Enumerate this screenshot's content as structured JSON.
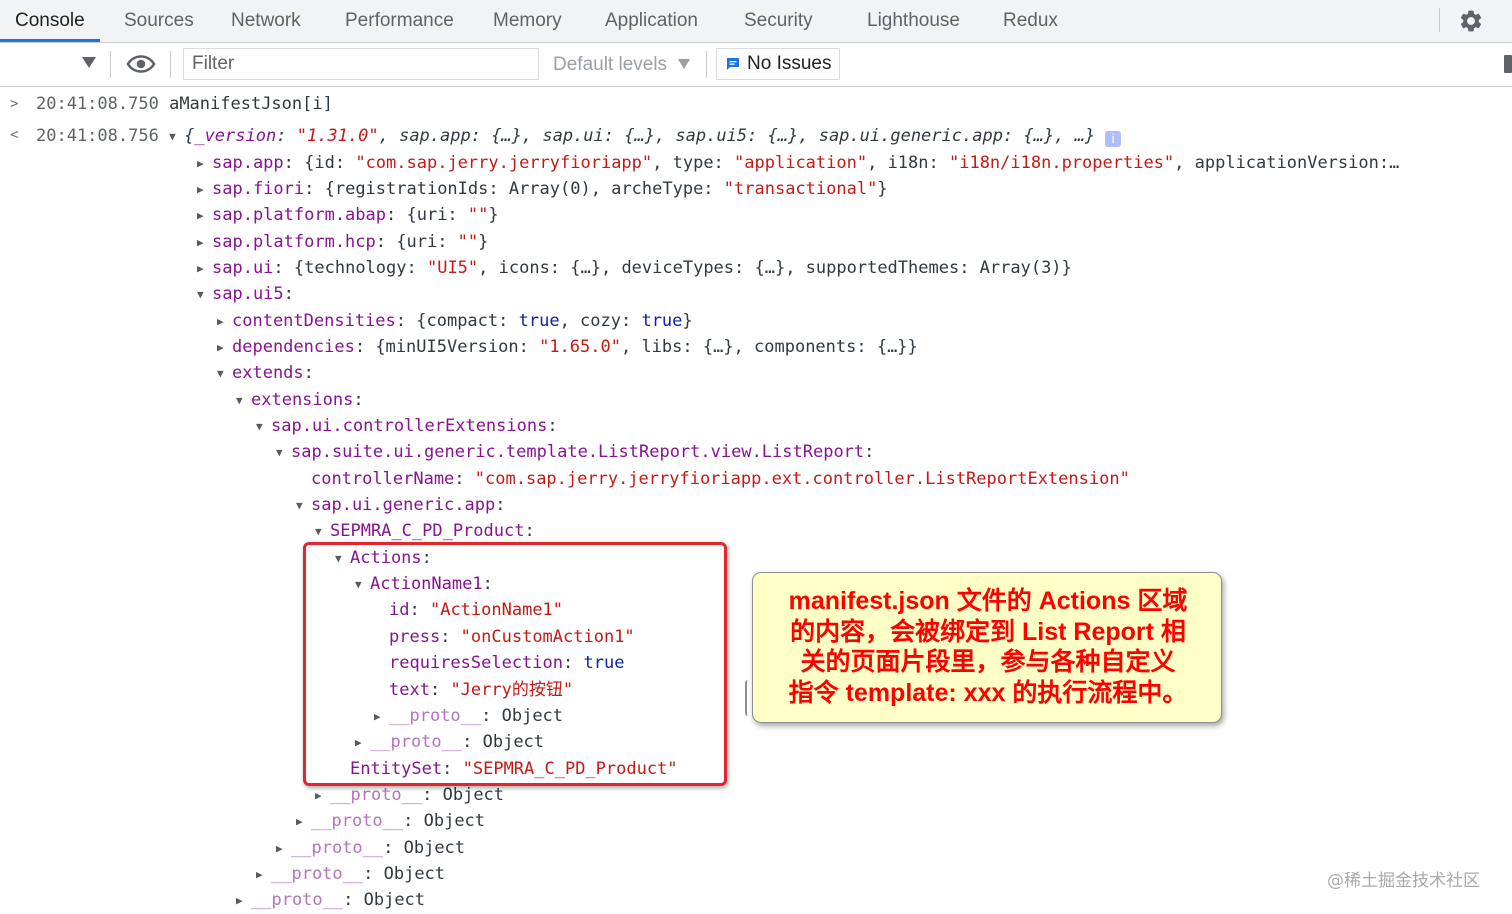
{
  "tabs": [
    {
      "label": "Console",
      "active": true
    },
    {
      "label": "Sources"
    },
    {
      "label": "Network"
    },
    {
      "label": "Performance"
    },
    {
      "label": "Memory"
    },
    {
      "label": "Application"
    },
    {
      "label": "Security"
    },
    {
      "label": "Lighthouse"
    },
    {
      "label": "Redux"
    }
  ],
  "toolbar": {
    "filter_placeholder": "Filter",
    "levels_label": "Default levels",
    "issues_label": "No Issues"
  },
  "console": {
    "input": {
      "time": "20:41:08.750",
      "expression": "aManifestJson[i]"
    },
    "result": {
      "time": "20:41:08.756",
      "preview": {
        "version_key": "_version",
        "version_value": "\"1.31.0\"",
        "rest": "sap.app: {…}, sap.ui: {…}, sap.ui5: {…}, sap.ui.generic.app: {…}, …}"
      },
      "badge": "i"
    },
    "lines": [
      {
        "indent": 1,
        "tri": "closed",
        "key": "sap.app",
        "value": "{id: \"com.sap.jerry.jerryfioriapp\", type: \"application\", i18n: \"i18n/i18n.properties\", applicationVersion:…"
      },
      {
        "indent": 1,
        "tri": "closed",
        "key": "sap.fiori",
        "value": "{registrationIds: Array(0), archeType: \"transactional\"}"
      },
      {
        "indent": 1,
        "tri": "closed",
        "key": "sap.platform.abap",
        "value": "{uri: \"\"}"
      },
      {
        "indent": 1,
        "tri": "closed",
        "key": "sap.platform.hcp",
        "value": "{uri: \"\"}"
      },
      {
        "indent": 1,
        "tri": "closed",
        "key": "sap.ui",
        "value": "{technology: \"UI5\", icons: {…}, deviceTypes: {…}, supportedThemes: Array(3)}"
      },
      {
        "indent": 1,
        "tri": "open",
        "key": "sap.ui5",
        "value": ""
      },
      {
        "indent": 2,
        "tri": "closed",
        "key": "contentDensities",
        "value": "{compact: true, cozy: true}"
      },
      {
        "indent": 2,
        "tri": "closed",
        "key": "dependencies",
        "value": "{minUI5Version: \"1.65.0\", libs: {…}, components: {…}}"
      },
      {
        "indent": 2,
        "tri": "open",
        "key": "extends",
        "value": ""
      },
      {
        "indent": 3,
        "tri": "open",
        "key": "extensions",
        "value": ""
      },
      {
        "indent": 4,
        "tri": "open",
        "key": "sap.ui.controllerExtensions",
        "value": ""
      },
      {
        "indent": 5,
        "tri": "open",
        "key": "sap.suite.ui.generic.template.ListReport.view.ListReport",
        "value": ""
      },
      {
        "indent": 6,
        "tri": "none",
        "key": "controllerName",
        "value": "\"com.sap.jerry.jerryfioriapp.ext.controller.ListReportExtension\""
      },
      {
        "indent": 6,
        "tri": "open",
        "key": "sap.ui.generic.app",
        "value": ""
      },
      {
        "indent": 7,
        "tri": "open",
        "key": "SEPMRA_C_PD_Product",
        "value": ""
      },
      {
        "indent": 8,
        "tri": "open",
        "key": "Actions",
        "value": ""
      },
      {
        "indent": 9,
        "tri": "open",
        "key": "ActionName1",
        "value": ""
      },
      {
        "indent": 10,
        "tri": "none",
        "key": "id",
        "value": "\"ActionName1\""
      },
      {
        "indent": 10,
        "tri": "none",
        "key": "press",
        "value": "\"onCustomAction1\""
      },
      {
        "indent": 10,
        "tri": "none",
        "key": "requiresSelection",
        "value": "true"
      },
      {
        "indent": 10,
        "tri": "none",
        "key": "text",
        "value": "\"Jerry的按钮\""
      },
      {
        "indent": 10,
        "tri": "closed",
        "key": "__proto__",
        "value": "Object"
      },
      {
        "indent": 9,
        "tri": "closed",
        "key": "__proto__",
        "value": "Object"
      },
      {
        "indent": 8,
        "tri": "none",
        "key": "EntitySet",
        "value": "\"SEPMRA_C_PD_Product\""
      },
      {
        "indent": 7,
        "tri": "closed",
        "key": "__proto__",
        "value": "Object"
      },
      {
        "indent": 6,
        "tri": "closed",
        "key": "__proto__",
        "value": "Object"
      },
      {
        "indent": 5,
        "tri": "closed",
        "key": "__proto__",
        "value": "Object"
      },
      {
        "indent": 4,
        "tri": "closed",
        "key": "__proto__",
        "value": "Object"
      },
      {
        "indent": 3,
        "tri": "closed",
        "key": "__proto__",
        "value": "Object"
      }
    ]
  },
  "annotation": {
    "callout_lines": [
      "manifest.json 文件的 Actions 区域",
      "的内容，会被绑定到 List Report 相",
      "关的页面片段里，参与各种自定义",
      "指令 template: xxx 的执行流程中。"
    ]
  },
  "watermark": "@稀土掘金技术社区",
  "colors": {
    "accent": "#1a73e8",
    "highlight": "#e3262e",
    "callout_bg": "#ffffc6",
    "callout_text": "#ff0000"
  }
}
